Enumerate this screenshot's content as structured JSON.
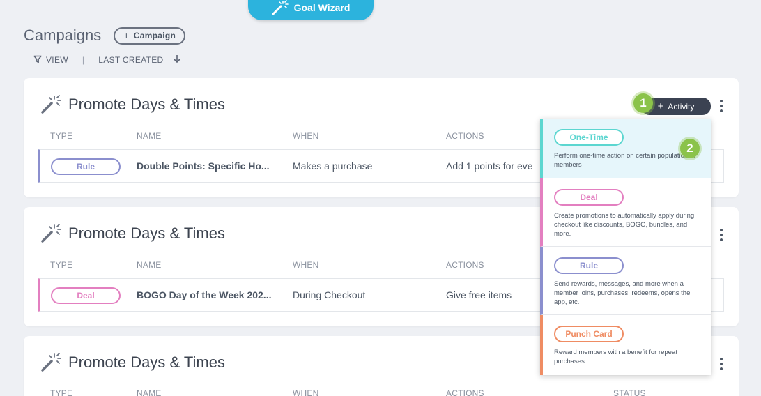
{
  "wizard": {
    "label": "Goal Wizard"
  },
  "header": {
    "title": "Campaigns",
    "add_label": "Campaign",
    "add_icon": "+"
  },
  "toolbar": {
    "view_label": "VIEW",
    "separator": "|",
    "sort_label": "LAST CREATED"
  },
  "columns": {
    "type": "TYPE",
    "name": "NAME",
    "when": "WHEN",
    "actions": "ACTIONS",
    "status": "STATUS"
  },
  "campaigns": [
    {
      "title": "Promote Days & Times",
      "type": "Rule",
      "name": "Double Points: Specific Ho...",
      "when": "Makes a purchase",
      "actions": "Add 1 points for eve"
    },
    {
      "title": "Promote Days & Times",
      "type": "Deal",
      "name": "BOGO Day of the Week 202...",
      "when": "During Checkout",
      "actions": "Give free items"
    },
    {
      "title": "Promote Days & Times"
    }
  ],
  "activity_button": {
    "label": "Activity",
    "icon": "+"
  },
  "badges": {
    "step1": "1",
    "step2": "2"
  },
  "activity_menu": [
    {
      "label": "One-Time",
      "desc": "Perform one-time action on certain population of members"
    },
    {
      "label": "Deal",
      "desc": "Create promotions to automatically apply during checkout like discounts, BOGO, bundles, and more."
    },
    {
      "label": "Rule",
      "desc": "Send rewards, messages, and more when a member joins, purchases, redeems, opens the app, etc."
    },
    {
      "label": "Punch Card",
      "desc": "Reward members with a benefit for repeat purchases"
    }
  ],
  "colors": {
    "one_time": "#5cd6d0",
    "deal": "#e37fc0",
    "rule": "#8b8fce",
    "punch_card": "#ef8c63",
    "accent": "#2cb3dd",
    "badge": "#8bc34a"
  }
}
